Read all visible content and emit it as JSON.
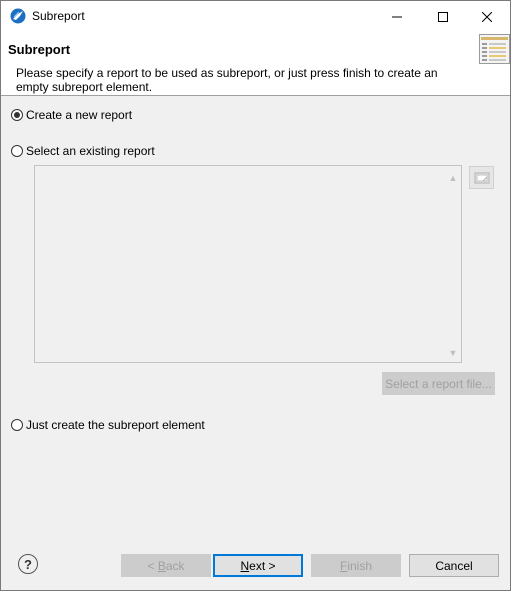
{
  "window": {
    "title": "Subreport",
    "icon": "jaspersoft-bird-icon",
    "controls": {
      "minimize": "minimize-icon",
      "maximize": "maximize-icon",
      "close": "close-icon"
    }
  },
  "header": {
    "title": "Subreport",
    "description": "Please specify a report to be used as subreport, or just press finish to create an empty subreport element.",
    "image": "subreport-wizard-banner-icon"
  },
  "options": {
    "create_new": {
      "label": "Create a new report",
      "checked": true
    },
    "select_existing": {
      "label": "Select an existing report",
      "checked": false
    },
    "just_create": {
      "label": "Just create the subreport element",
      "checked": false
    }
  },
  "existing": {
    "list_items": [],
    "select_file_label": "Select a report file...",
    "workspace_button_icon": "workspace-browse-icon"
  },
  "footer": {
    "help_icon": "help-icon",
    "back_label_prefix": "< ",
    "back_label_mnemonic": "B",
    "back_label_rest": "ack",
    "next_label_mnemonic": "N",
    "next_label_rest": "ext >",
    "finish_label_mnemonic": "F",
    "finish_label_rest": "inish",
    "cancel_label": "Cancel"
  }
}
